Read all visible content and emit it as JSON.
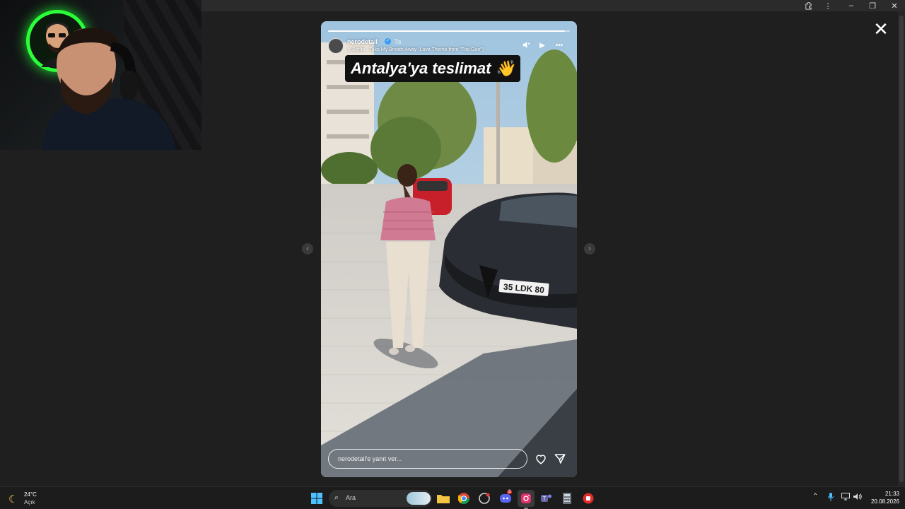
{
  "story": {
    "username": "nerodetail",
    "time_ago": "7s",
    "music": "Berlin · Take My Breath Away (Love Theme from \"Top Gun\")",
    "caption": "Antalya'ya teslimat 👋",
    "reply_placeholder": "nerodetail'e yanıt ver...",
    "progress": 0.98,
    "license_plate": "35 LDK 80"
  },
  "controls": {
    "mute_icon": "speaker-icon",
    "play_icon": "play-icon",
    "more_icon": "more-icon",
    "close_icon": "close-icon"
  },
  "taskbar": {
    "weather_temp": "24°C",
    "weather_condition": "Açık",
    "search_label": "Ara",
    "time": "21:33",
    "date": "20.08.2026",
    "badge_count": "3"
  },
  "colors": {
    "accent_green": "#2bff3a",
    "instagram": "#e1306c"
  }
}
